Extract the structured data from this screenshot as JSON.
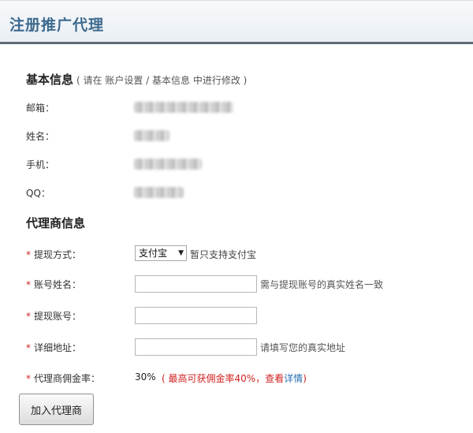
{
  "header": {
    "title": "注册推广代理"
  },
  "basic": {
    "title": "基本信息",
    "note": "( 请在 账户设置 / 基本信息 中进行修改 )",
    "fields": [
      {
        "label": "邮箱："
      },
      {
        "label": "姓名："
      },
      {
        "label": "手机："
      },
      {
        "label": "QQ："
      }
    ]
  },
  "agent": {
    "title": "代理商信息",
    "required_mark": "*",
    "withdraw_method": {
      "label": "提现方式：",
      "selected": "支付宝",
      "note": "暂只支持支付宝"
    },
    "account_name": {
      "label": "账号姓名：",
      "value": "",
      "hint": "需与提现账号的真实姓名一致"
    },
    "withdraw_account": {
      "label": "提现账号：",
      "value": ""
    },
    "address": {
      "label": "详细地址：",
      "value": "",
      "hint": "请填写您的真实地址"
    },
    "commission": {
      "label": "代理商佣金率：",
      "value": "30%",
      "note_prefix": "( 最高可获佣金率40%，查看",
      "link": "详情",
      "note_suffix": ")"
    }
  },
  "submit": {
    "label": "加入代理商"
  }
}
